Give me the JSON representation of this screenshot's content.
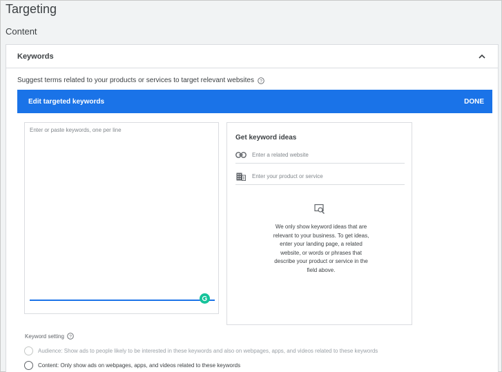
{
  "page": {
    "title": "Targeting",
    "section": "Content"
  },
  "keywords_panel": {
    "header": "Keywords",
    "suggest_text": "Suggest terms related to your products or services to target relevant websites",
    "edit_bar": {
      "title": "Edit targeted keywords",
      "done_label": "DONE"
    },
    "keyword_input": {
      "placeholder": "Enter or paste keywords, one per line",
      "value": ""
    },
    "ideas": {
      "title": "Get keyword ideas",
      "website_placeholder": "Enter a related website",
      "product_placeholder": "Enter your product or service",
      "info_text": "We only show keyword ideas that are relevant to your business. To get ideas, enter your landing page, a related website, or words or phrases that describe your product or service in the field above."
    },
    "keyword_setting": {
      "label": "Keyword setting",
      "options": [
        {
          "label": "Audience: Show ads to people likely to be interested in these keywords and also on webpages, apps, and videos related to these keywords",
          "enabled": false
        },
        {
          "label": "Content: Only show ads on webpages, apps, and videos related to these keywords",
          "enabled": true
        }
      ]
    }
  },
  "colors": {
    "accent": "#1a73e8",
    "grammarly": "#15c39a"
  },
  "icons": [
    "chevron-up-icon",
    "help-icon",
    "grammarly-icon",
    "link-icon",
    "building-icon",
    "search-page-icon"
  ]
}
